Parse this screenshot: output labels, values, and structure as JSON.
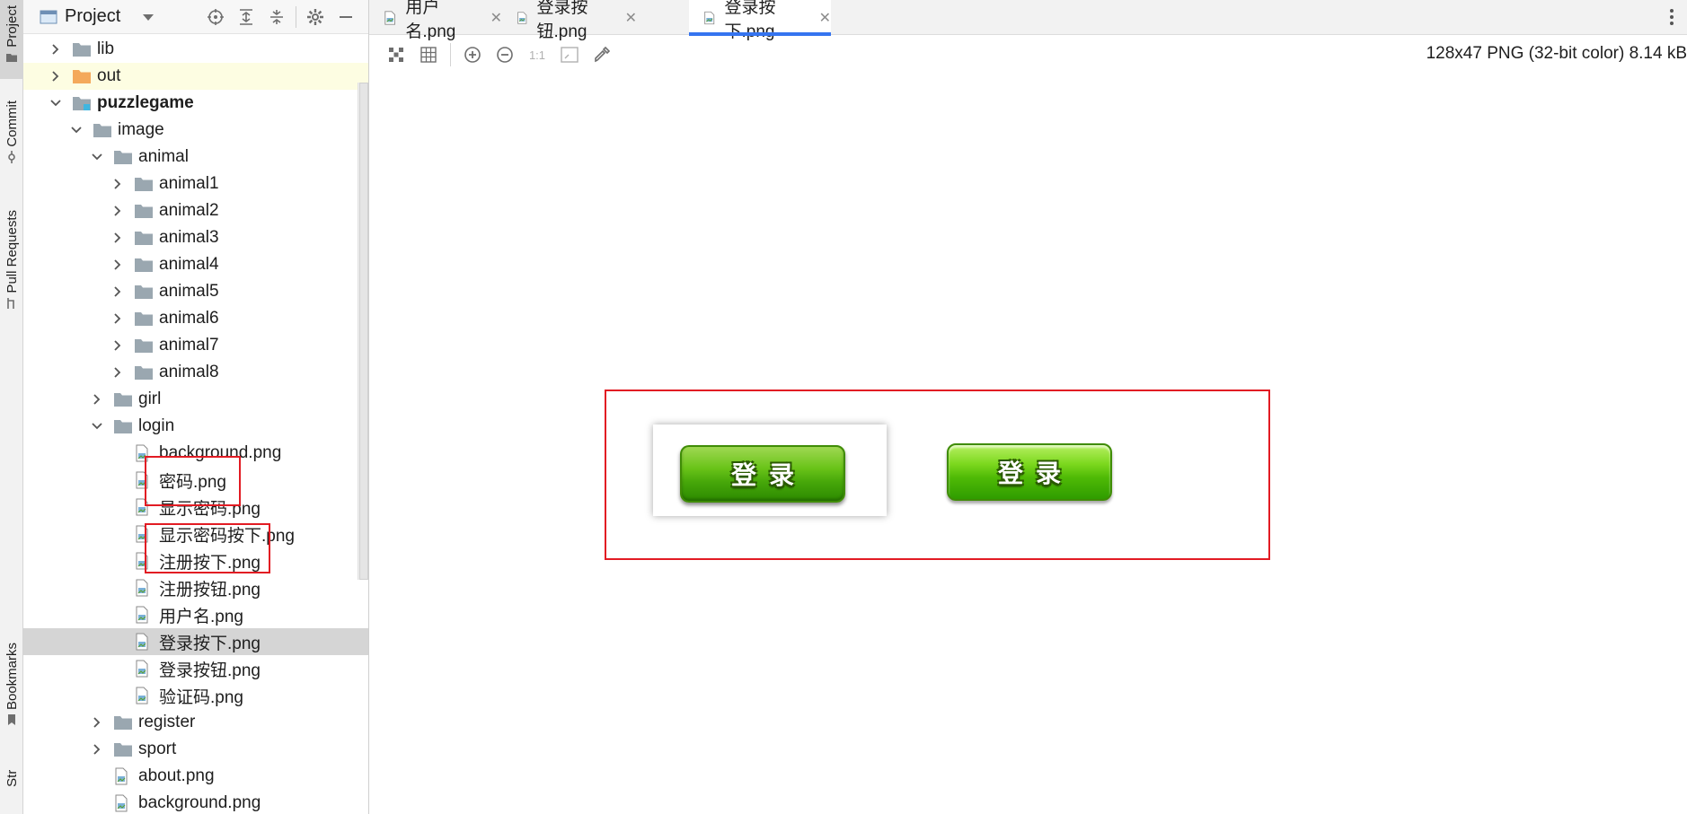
{
  "tool_strip": {
    "project": "Project",
    "commit": "Commit",
    "pull_requests": "Pull Requests",
    "bookmarks": "Bookmarks",
    "structure": "Structure"
  },
  "project_panel": {
    "title": "Project"
  },
  "tree": [
    {
      "label": "lib",
      "indent": 1,
      "type": "folder",
      "expand": "closed"
    },
    {
      "label": "out",
      "indent": 1,
      "type": "folder-orange",
      "expand": "closed"
    },
    {
      "label": "puzzlegame",
      "indent": 1,
      "type": "module",
      "expand": "open"
    },
    {
      "label": "image",
      "indent": 2,
      "type": "folder",
      "expand": "open"
    },
    {
      "label": "animal",
      "indent": 3,
      "type": "folder",
      "expand": "open"
    },
    {
      "label": "animal1",
      "indent": 4,
      "type": "folder",
      "expand": "closed"
    },
    {
      "label": "animal2",
      "indent": 4,
      "type": "folder",
      "expand": "closed"
    },
    {
      "label": "animal3",
      "indent": 4,
      "type": "folder",
      "expand": "closed"
    },
    {
      "label": "animal4",
      "indent": 4,
      "type": "folder",
      "expand": "closed"
    },
    {
      "label": "animal5",
      "indent": 4,
      "type": "folder",
      "expand": "closed"
    },
    {
      "label": "animal6",
      "indent": 4,
      "type": "folder",
      "expand": "closed"
    },
    {
      "label": "animal7",
      "indent": 4,
      "type": "folder",
      "expand": "closed"
    },
    {
      "label": "animal8",
      "indent": 4,
      "type": "folder",
      "expand": "closed"
    },
    {
      "label": "girl",
      "indent": 3,
      "type": "folder",
      "expand": "closed"
    },
    {
      "label": "login",
      "indent": 3,
      "type": "folder",
      "expand": "open"
    },
    {
      "label": "background.png",
      "indent": 4,
      "type": "image",
      "expand": "none"
    },
    {
      "label": "密码.png",
      "indent": 4,
      "type": "image",
      "expand": "none"
    },
    {
      "label": "显示密码.png",
      "indent": 4,
      "type": "image",
      "expand": "none"
    },
    {
      "label": "显示密码按下.png",
      "indent": 4,
      "type": "image",
      "expand": "none"
    },
    {
      "label": "注册按下.png",
      "indent": 4,
      "type": "image",
      "expand": "none"
    },
    {
      "label": "注册按钮.png",
      "indent": 4,
      "type": "image",
      "expand": "none"
    },
    {
      "label": "用户名.png",
      "indent": 4,
      "type": "image",
      "expand": "none"
    },
    {
      "label": "登录按下.png",
      "indent": 4,
      "type": "image",
      "expand": "none"
    },
    {
      "label": "登录按钮.png",
      "indent": 4,
      "type": "image",
      "expand": "none"
    },
    {
      "label": "验证码.png",
      "indent": 4,
      "type": "image",
      "expand": "none"
    },
    {
      "label": "register",
      "indent": 3,
      "type": "folder",
      "expand": "closed"
    },
    {
      "label": "sport",
      "indent": 3,
      "type": "folder",
      "expand": "closed"
    },
    {
      "label": "about.png",
      "indent": 3,
      "type": "image",
      "expand": "none"
    },
    {
      "label": "background.png",
      "indent": 3,
      "type": "image",
      "expand": "none"
    }
  ],
  "tabs": [
    {
      "label": "用户名.png",
      "active": false
    },
    {
      "label": "登录按钮.png",
      "active": false
    },
    {
      "label": "登录按下.png",
      "active": true
    }
  ],
  "image_info": "128x47 PNG (32-bit color) 8.14 kB",
  "toolbar": {
    "actual_size_label": "1:1"
  },
  "preview": {
    "pressed_button_text": "登录",
    "normal_button_text": "登录"
  },
  "colors": {
    "accent": "#3574f0",
    "annotation_red": "#e21b23",
    "selection": "#d5d5d5",
    "highlight_yellow": "#fdfde2"
  }
}
